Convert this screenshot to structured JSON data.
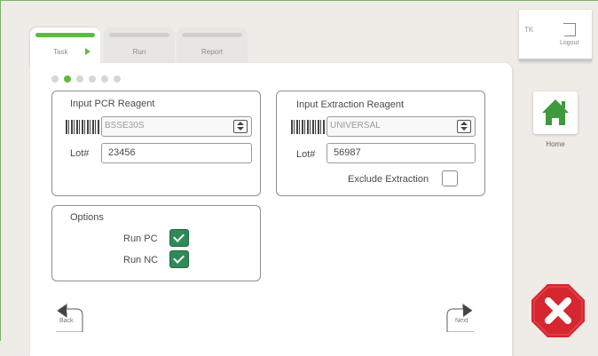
{
  "tabs": [
    {
      "label": "Task",
      "active": true
    },
    {
      "label": "Run",
      "active": false
    },
    {
      "label": "Report",
      "active": false
    }
  ],
  "steps": {
    "total": 6,
    "current": 2
  },
  "pcr": {
    "title": "Input PCR Reagent",
    "reagent": "BSSE30S",
    "lot_label": "Lot#",
    "lot": "23456"
  },
  "extraction": {
    "title": "Input Extraction Reagent",
    "reagent": "UNIVERSAL",
    "lot_label": "Lot#",
    "lot": "56987",
    "exclude_label": "Exclude Extraction",
    "exclude_checked": false
  },
  "options": {
    "title": "Options",
    "run_pc_label": "Run PC",
    "run_pc_checked": true,
    "run_nc_label": "Run NC",
    "run_nc_checked": true
  },
  "nav": {
    "back_label": "Back",
    "next_label": "Next"
  },
  "user": {
    "initials": "TK",
    "logout_label": "Logout"
  },
  "home": {
    "label": "Home"
  },
  "colors": {
    "accent": "#5cbd3c",
    "checkbox": "#2f8a58",
    "cancel": "#d62630",
    "home": "#3f9a3c"
  },
  "icons": {
    "home": "home-icon",
    "cancel": "close-icon",
    "logout": "logout-icon",
    "back": "back-arrow-icon",
    "next": "next-arrow-icon"
  }
}
